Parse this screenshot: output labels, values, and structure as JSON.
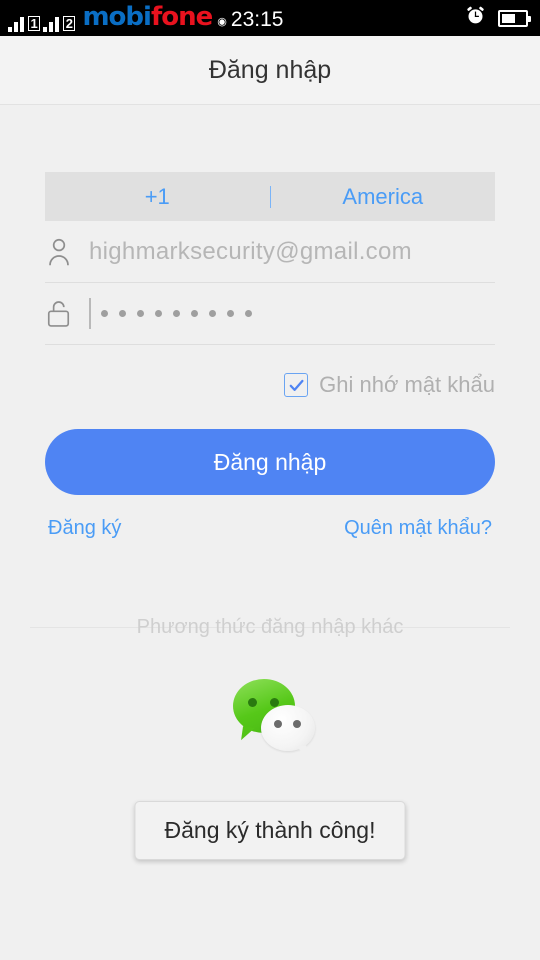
{
  "statusbar": {
    "sim1_label": "1",
    "sim2_label": "2",
    "carrier_part1": "mobi",
    "carrier_part2": "fone",
    "wifi_icon": "wifi-icon",
    "time": "23:15",
    "alarm_icon": "alarm-clock-icon",
    "battery_icon": "battery-icon",
    "battery_level": "58%"
  },
  "header": {
    "title": "Đăng nhập"
  },
  "form": {
    "country_code": "+1",
    "country_name": "America",
    "user_icon": "person-icon",
    "email_value": "highmarksecurity@gmail.com",
    "email_placeholder": "highmarksecurity@gmail.com",
    "lock_icon": "unlocked-padlock-icon",
    "password_masked": "•••••••••",
    "password_dot_count": 9,
    "remember_checked": true,
    "check_icon": "checkmark-icon",
    "remember_label": "Ghi nhớ mật khẩu",
    "login_button": "Đăng nhập",
    "register_link": "Đăng ký",
    "forgot_link": "Quên mật khẩu?"
  },
  "alt_login": {
    "divider_text": "Phương thức đăng nhập khác",
    "wechat_icon": "wechat-icon"
  },
  "toast": {
    "message": "Đăng ký thành công!"
  },
  "colors": {
    "accent_blue": "#4a9cf6",
    "button_blue": "#4f84f3",
    "page_bg": "#f0f0f0",
    "carrier_blue": "#0a6ec4",
    "carrier_red": "#e8121e",
    "wechat_green": "#56c819"
  }
}
